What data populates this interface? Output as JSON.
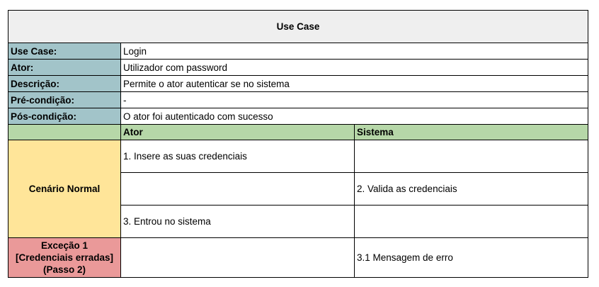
{
  "title": "Use Case",
  "fields": [
    {
      "label": "Use Case:",
      "value": "Login"
    },
    {
      "label": "Ator:",
      "value": "Utilizador com password"
    },
    {
      "label": "Descrição:",
      "value": "Permite o ator autenticar se no sistema"
    },
    {
      "label": "Pré-condição:",
      "value": "-"
    },
    {
      "label": "Pós-condição:",
      "value": "O ator foi autenticado com sucesso"
    }
  ],
  "columns": {
    "actor": "Ator",
    "system": "Sistema"
  },
  "normal_scenario": {
    "label": "Cenário Normal",
    "steps": [
      {
        "actor": "1. Insere as suas credenciais",
        "system": ""
      },
      {
        "actor": "",
        "system": "2. Valida as credenciais"
      },
      {
        "actor": "3. Entrou no sistema",
        "system": ""
      }
    ]
  },
  "exception": {
    "label_lines": [
      "Exceção 1",
      "[Credenciais erradas]",
      "(Passo 2)"
    ],
    "actor": "",
    "system": "3.1 Mensagem de erro"
  },
  "colors": {
    "title_bg": "#efefef",
    "label_bg": "#a2c4c9",
    "header_bg": "#b6d7a8",
    "normal_bg": "#ffe599",
    "exception_bg": "#ea9999"
  }
}
